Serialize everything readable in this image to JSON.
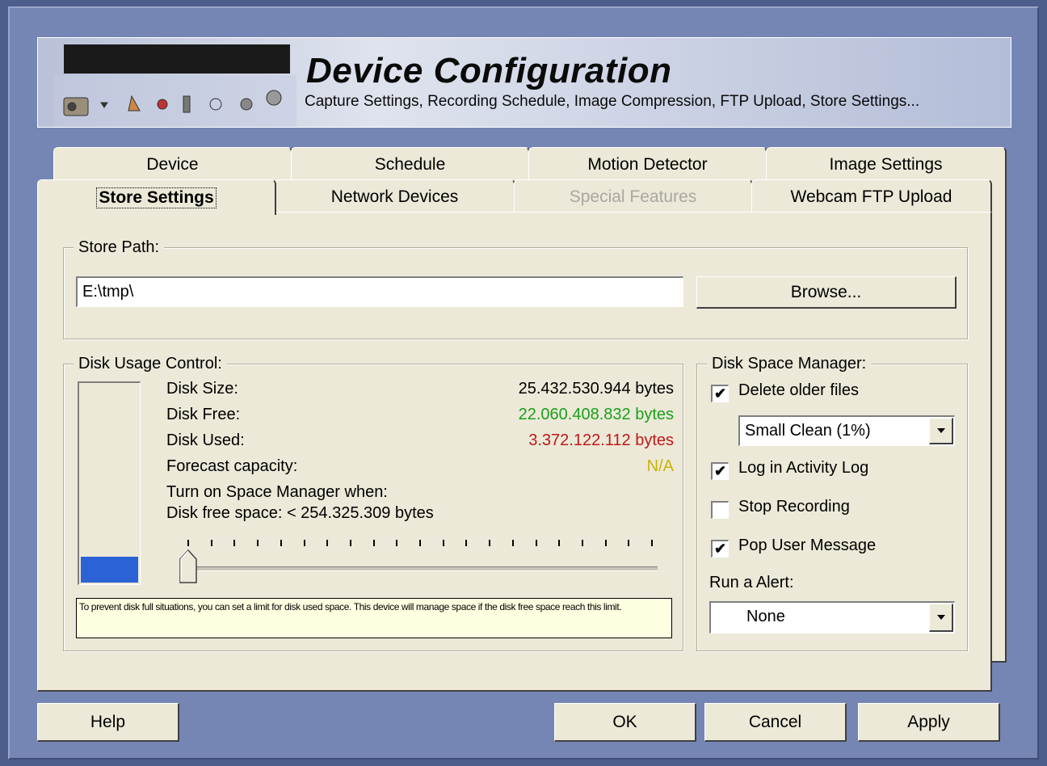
{
  "banner": {
    "title": "Device Configuration",
    "subtitle": "Capture Settings, Recording Schedule,  Image Compression, FTP Upload, Store Settings..."
  },
  "tabs_back": [
    {
      "label": "Device"
    },
    {
      "label": "Schedule"
    },
    {
      "label": "Motion Detector"
    },
    {
      "label": "Image Settings"
    }
  ],
  "tabs_front": [
    {
      "label": "Store Settings",
      "active": true
    },
    {
      "label": "Network Devices"
    },
    {
      "label": "Special Features",
      "disabled": true
    },
    {
      "label": "Webcam FTP Upload"
    }
  ],
  "store_path": {
    "group_label": "Store Path:",
    "value": "E:\\tmp\\",
    "browse_label": "Browse..."
  },
  "disk_usage": {
    "group_label": "Disk Usage Control:",
    "size_label": "Disk Size:",
    "size_value": "25.432.530.944 bytes",
    "free_label": "Disk Free:",
    "free_value": "22.060.408.832 bytes",
    "used_label": "Disk Used:",
    "used_value": "3.372.122.112 bytes",
    "forecast_label": "Forecast capacity:",
    "forecast_value": "N/A",
    "turn_on_label": "Turn on Space Manager when:",
    "threshold_label": "Disk free space: < 254.325.309 bytes",
    "meter_used_fraction": 0.13,
    "slider_position_fraction": 0.0,
    "hint": "To prevent disk full situations, you can set a limit for disk used space. This device will manage space if the disk free space reach this limit.",
    "colors": {
      "free": "#1aa01a",
      "used": "#c01818",
      "forecast": "#c8b400"
    }
  },
  "space_manager": {
    "group_label": "Disk Space Manager:",
    "delete_older_label": "Delete older files",
    "delete_older_checked": true,
    "clean_mode": "Small Clean (1%)",
    "log_label": "Log in Activity Log",
    "log_checked": true,
    "stop_label": "Stop Recording",
    "stop_checked": false,
    "pop_label": "Pop User Message",
    "pop_checked": true,
    "alert_label": "Run a Alert:",
    "alert_value": "None"
  },
  "footer": {
    "help": "Help",
    "ok": "OK",
    "cancel": "Cancel",
    "apply": "Apply"
  },
  "icons": [
    "camera-icon",
    "dropdown-arrow-icon",
    "tool-icons",
    "checkmark-icon"
  ]
}
